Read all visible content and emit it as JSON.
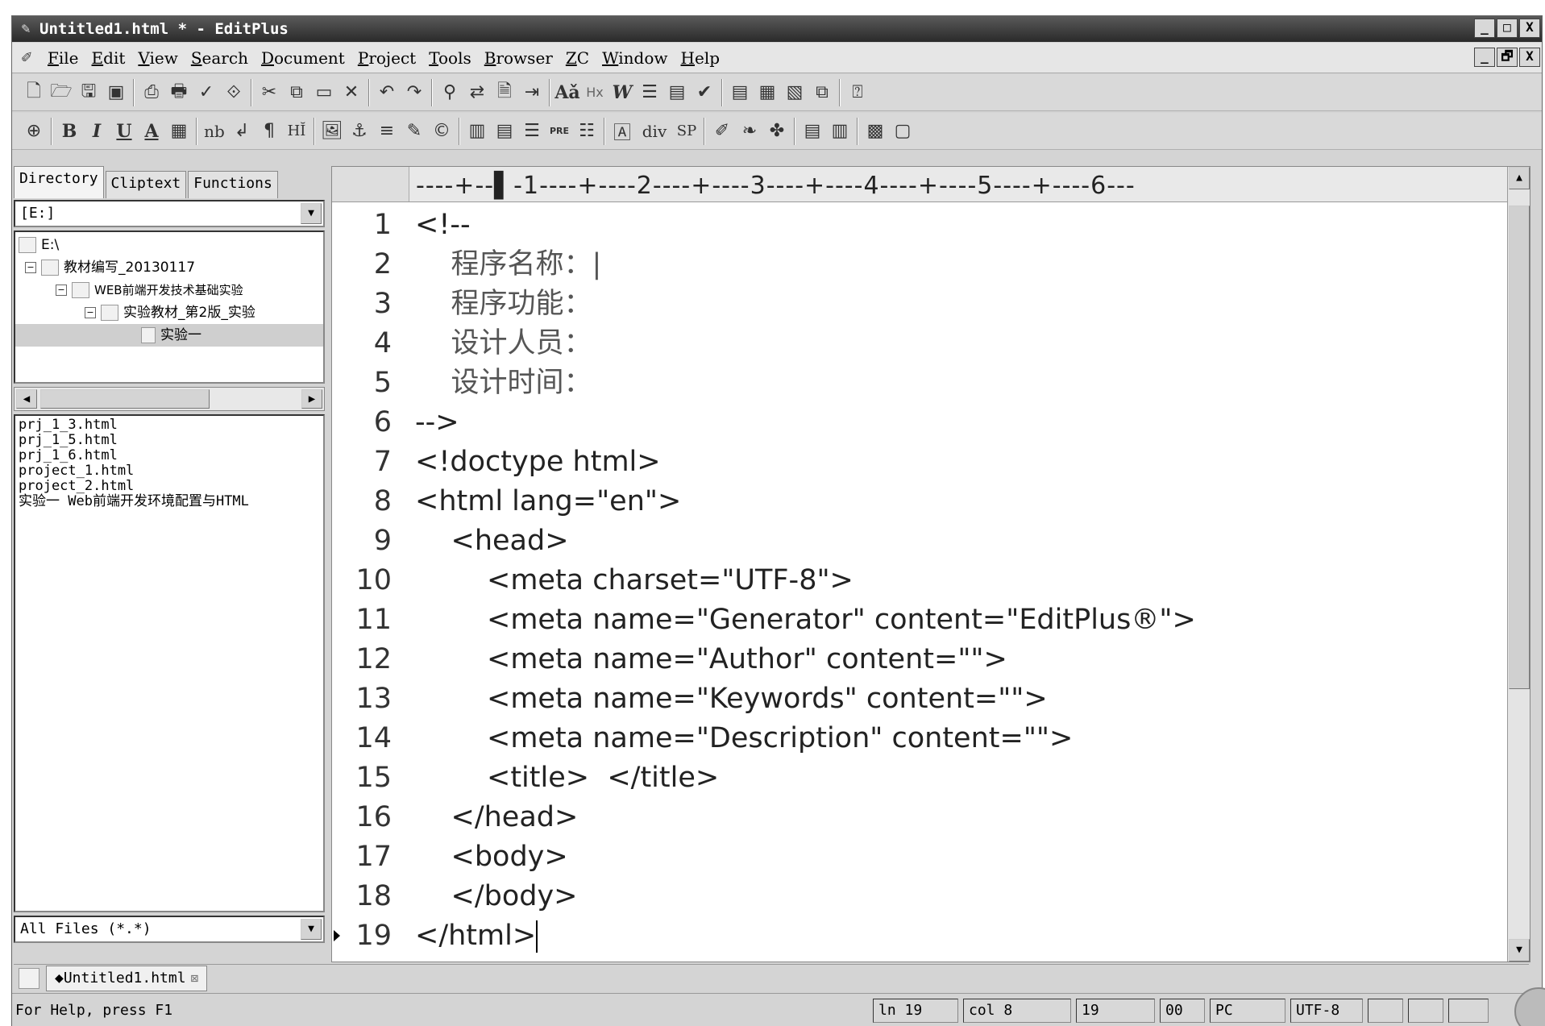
{
  "window": {
    "title": "Untitled1.html * - EditPlus",
    "buttons": [
      "_",
      "□",
      "X"
    ],
    "mdi_buttons": [
      "_",
      "🗗",
      "X"
    ]
  },
  "menu": [
    "File",
    "Edit",
    "View",
    "Search",
    "Document",
    "Project",
    "Tools",
    "Browser",
    "ZC",
    "Window",
    "Help"
  ],
  "toolbar1": {
    "icons": [
      "new-file-icon",
      "open-folder-icon",
      "save-icon",
      "save-all-icon",
      "print-preview-icon",
      "print-icon",
      "spell-check-icon",
      "code-icon",
      "cut-icon",
      "copy-icon",
      "paste-icon",
      "delete-icon",
      "undo-icon",
      "redo-icon",
      "find-icon",
      "replace-icon",
      "find-in-files-icon",
      "goto-icon",
      "font-size-icon",
      "hex-icon",
      "word-wrap-icon",
      "line-number-icon",
      "column-icon",
      "check-icon",
      "window-icon",
      "document-icon",
      "output-icon",
      "restore-icon",
      "help-icon"
    ],
    "labels": {
      "aa": "Aǎ",
      "hx": "Hx",
      "w": "W"
    }
  },
  "toolbar2": {
    "labels": [
      "B",
      "I",
      "U",
      "A",
      "nb",
      "↲",
      "¶",
      "HĬ",
      "div",
      "SP"
    ]
  },
  "left_panel": {
    "tabs": [
      "Directory",
      "Cliptext",
      "Functions"
    ],
    "drive": "[E:]",
    "tree": [
      {
        "label": "E:\\",
        "expander": ""
      },
      {
        "label": "教材编写_20130117",
        "expander": "⊟"
      },
      {
        "label": "WEB前端开发技术基础实验",
        "expander": "⊟"
      },
      {
        "label": "实验教材_第2版_实验",
        "expander": "⊟"
      },
      {
        "label": "实验一",
        "expander": ""
      }
    ],
    "files": [
      "prj_1_3.html",
      "prj_1_5.html",
      "prj_1_6.html",
      "project_1.html",
      "project_2.html",
      "实验一 Web前端开发环境配置与HTML"
    ],
    "filter": "All Files (*.*)"
  },
  "editor": {
    "ruler": "----+--▌-1----+----2----+----3----+----4----+----5----+----6---",
    "lines": [
      {
        "n": "1",
        "text": "<!--"
      },
      {
        "n": "2",
        "text": "    程序名称：|"
      },
      {
        "n": "3",
        "text": "    程序功能："
      },
      {
        "n": "4",
        "text": "    设计人员："
      },
      {
        "n": "5",
        "text": "    设计时间："
      },
      {
        "n": "6",
        "text": "-->"
      },
      {
        "n": "7",
        "text": "<!doctype html>"
      },
      {
        "n": "8",
        "text": "<html lang=\"en\">"
      },
      {
        "n": "9",
        "text": "    <head>"
      },
      {
        "n": "10",
        "text": "        <meta charset=\"UTF-8\">"
      },
      {
        "n": "11",
        "text": "        <meta name=\"Generator\" content=\"EditPlus®\">"
      },
      {
        "n": "12",
        "text": "        <meta name=\"Author\" content=\"\">"
      },
      {
        "n": "13",
        "text": "        <meta name=\"Keywords\" content=\"\">"
      },
      {
        "n": "14",
        "text": "        <meta name=\"Description\" content=\"\">"
      },
      {
        "n": "15",
        "text": "        <title>  </title>"
      },
      {
        "n": "16",
        "text": "    </head>"
      },
      {
        "n": "17",
        "text": "    <body>"
      },
      {
        "n": "18",
        "text": "    </body>"
      },
      {
        "n": "19",
        "text": "</html>"
      }
    ]
  },
  "doc_tab": {
    "label": "◆Untitled1.html",
    "close": "⊠"
  },
  "status": {
    "help": "For Help, press F1",
    "line": "ln 19",
    "col": "col 8",
    "total": "19",
    "hex": "00",
    "eol": "PC",
    "encoding": "UTF-8"
  }
}
